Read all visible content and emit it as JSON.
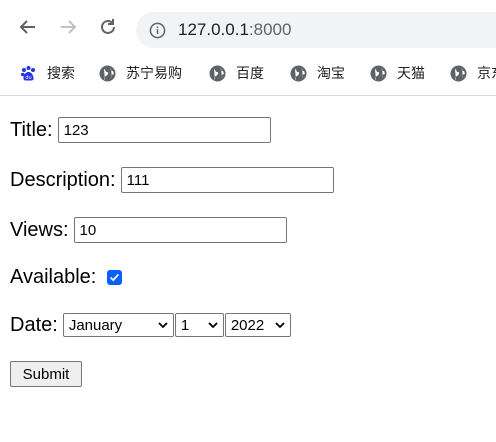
{
  "browser": {
    "url_host": "127.0.0.1",
    "url_port": ":8000",
    "bookmarks": [
      {
        "label": "搜索",
        "icon": "baidu-paw-icon"
      },
      {
        "label": "苏宁易购",
        "icon": "globe-icon"
      },
      {
        "label": "百度",
        "icon": "globe-icon"
      },
      {
        "label": "淘宝",
        "icon": "globe-icon"
      },
      {
        "label": "天猫",
        "icon": "globe-icon"
      },
      {
        "label": "京东",
        "icon": "globe-icon"
      }
    ]
  },
  "form": {
    "title_label": "Title:",
    "title_value": "123",
    "description_label": "Description:",
    "description_value": "111",
    "views_label": "Views:",
    "views_value": "10",
    "available_label": "Available:",
    "available_checked": true,
    "date_label": "Date:",
    "month_value": "January",
    "day_value": "1",
    "year_value": "2022",
    "submit_label": "Submit"
  },
  "colors": {
    "checkbox_accent": "#0a5fff",
    "baidu_blue": "#2932e1"
  }
}
